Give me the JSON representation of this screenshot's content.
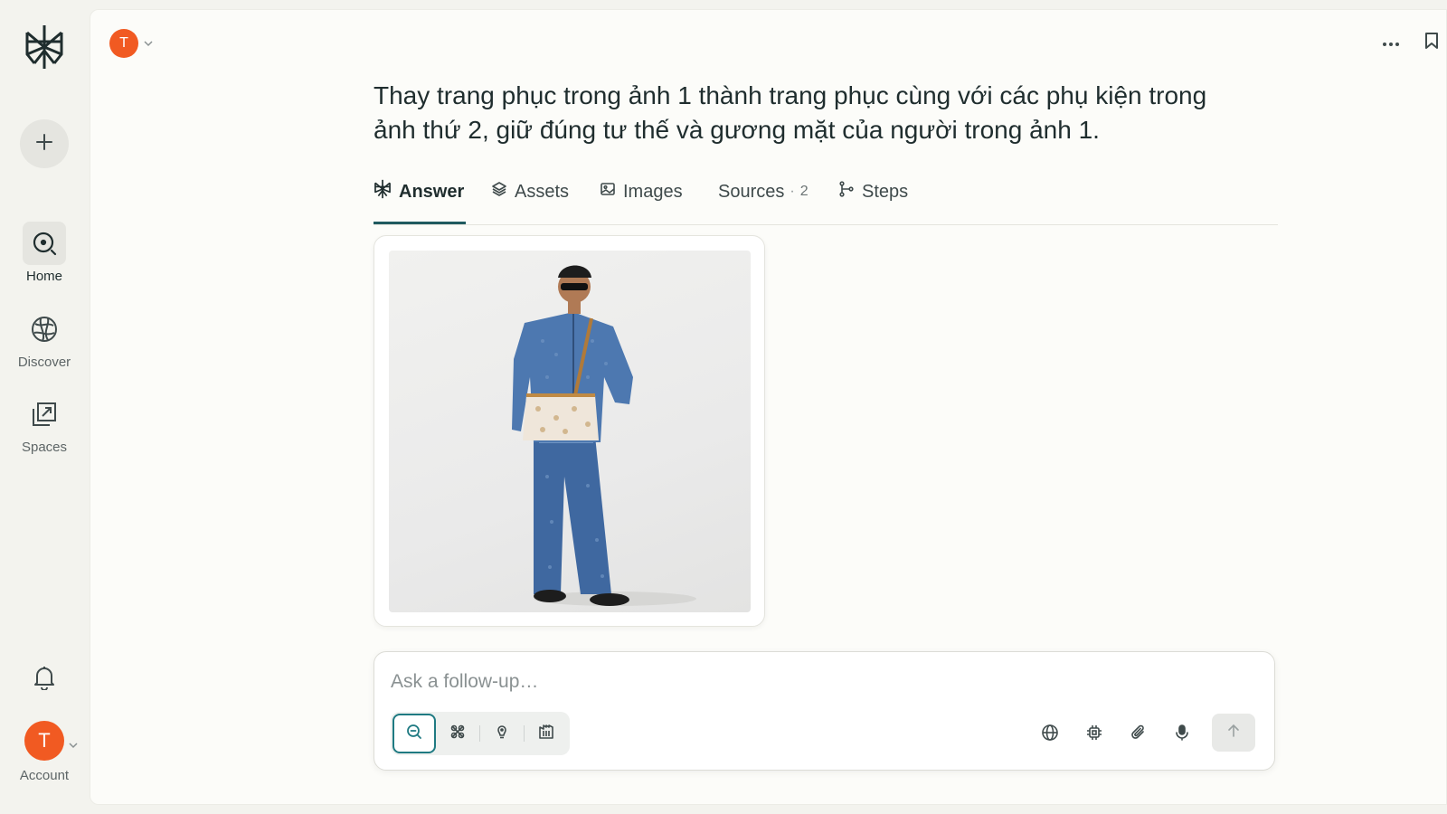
{
  "sidebar": {
    "logo": "perplexity-logo",
    "new_thread": "plus-icon",
    "items": [
      {
        "label": "Home",
        "icon": "home-search-icon",
        "active": true
      },
      {
        "label": "Discover",
        "icon": "globe-icon",
        "active": false
      },
      {
        "label": "Spaces",
        "icon": "spaces-icon",
        "active": false
      }
    ],
    "notifications_icon": "bell-icon",
    "account": {
      "initial": "T",
      "label": "Account"
    }
  },
  "header": {
    "user_initial": "T",
    "more_icon": "ellipsis-icon",
    "bookmark_icon": "bookmark-icon"
  },
  "query": "Thay trang phục trong ảnh 1 thành trang phục cùng với các phụ kiện trong ảnh thứ 2, giữ đúng tư thế và gương mặt của người trong ảnh 1.",
  "tabs": [
    {
      "label": "Answer",
      "icon": "perplexity-icon",
      "active": true
    },
    {
      "label": "Assets",
      "icon": "layers-icon"
    },
    {
      "label": "Images",
      "icon": "image-icon"
    },
    {
      "label": "Sources",
      "count": "2"
    },
    {
      "label": "Steps",
      "icon": "steps-icon"
    }
  ],
  "result_image": {
    "alt": "generated-image"
  },
  "composer": {
    "placeholder": "Ask a follow-up…",
    "modes": [
      "search-icon",
      "research-icon",
      "lightbulb-icon",
      "labs-icon"
    ],
    "tools": [
      "globe-icon",
      "chip-icon",
      "paperclip-icon",
      "microphone-icon"
    ],
    "send_icon": "arrow-up-icon"
  },
  "colors": {
    "accent": "#1f7a82",
    "avatar": "#f15a22",
    "background": "#f3f3ee",
    "panel": "#fcfcf9"
  }
}
